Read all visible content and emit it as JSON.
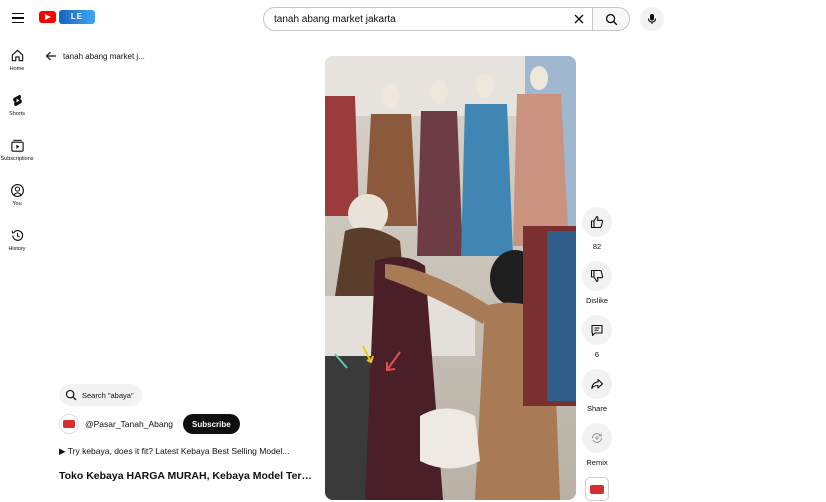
{
  "header": {
    "logo_badge": "LE",
    "search": {
      "value": "tanah abang market jakarta",
      "placeholder": "Search"
    }
  },
  "sidebar": {
    "items": [
      {
        "label": "Home",
        "icon": "home-icon"
      },
      {
        "label": "Shorts",
        "icon": "shorts-icon"
      },
      {
        "label": "Subscriptions",
        "icon": "subscriptions-icon"
      },
      {
        "label": "You",
        "icon": "you-icon"
      },
      {
        "label": "History",
        "icon": "history-icon"
      }
    ]
  },
  "query_back": {
    "text": "tanah abang market j..."
  },
  "video": {
    "scene": "shop-interior",
    "suggestion": "Search \"abaya\"",
    "channel": {
      "handle": "@Pasar_Tanah_Abang",
      "subscribe_label": "Subscribe"
    },
    "playlist_line": "▶ Try kebaya, does it fit? Latest Kebaya Best Selling Model...",
    "title": "Toko Kebaya HARGA MURAH, Kebaya Model Terbaru"
  },
  "actions": {
    "like_count": "82",
    "dislike_label": "Dislike",
    "comment_count": "6",
    "share_label": "Share",
    "remix_label": "Remix"
  },
  "colors": {
    "brand_red": "#ff0000",
    "subscribe_bg": "#0f0f0f",
    "chip_bg": "#f2f2f2"
  }
}
